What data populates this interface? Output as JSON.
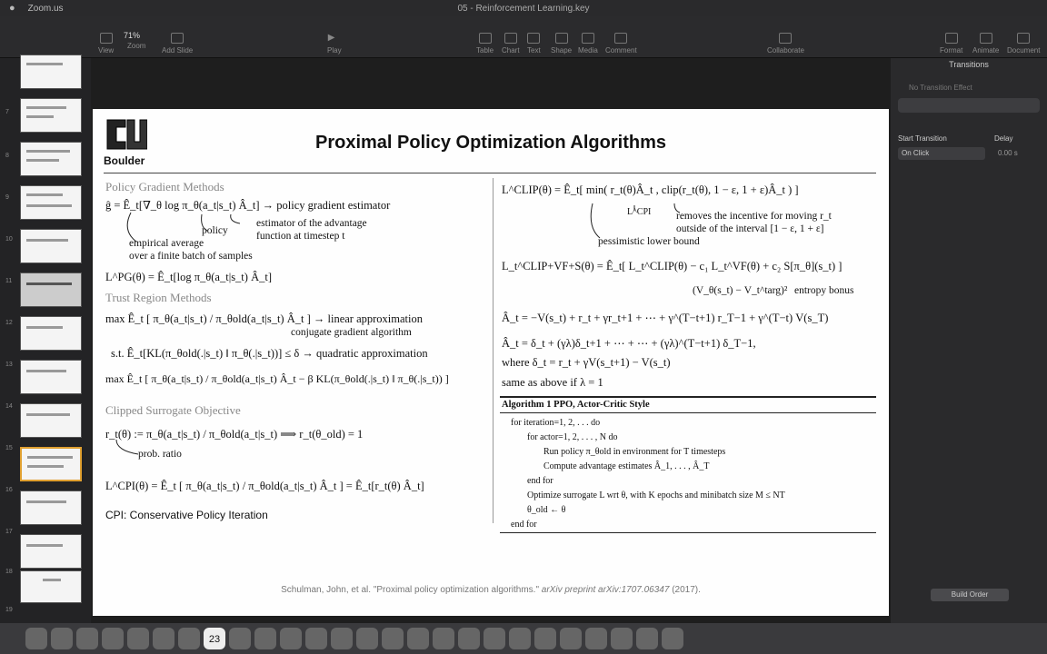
{
  "app": {
    "window_title": "05 - Reinforcement Learning.key",
    "menu_left": "Zoom.us",
    "zoom_level": "71%"
  },
  "toolbar": {
    "items": [
      "View",
      "Zoom",
      "Add Slide",
      "Play",
      "Table",
      "Chart",
      "Text",
      "Shape",
      "Media",
      "Comment",
      "Collaborate",
      "Format",
      "Animate",
      "Document"
    ]
  },
  "sidebar": {
    "slide_numbers": [
      "7",
      "8",
      "9",
      "10",
      "11",
      "12",
      "13",
      "14",
      "15",
      "16",
      "17",
      "18",
      "19"
    ]
  },
  "inspector": {
    "tab": "Transitions",
    "none": "No Transition Effect",
    "start_transition_label": "Start Transition",
    "delay_label": "Delay",
    "start_value": "On Click",
    "delay_value": "0.00 s",
    "build_order": "Build Order"
  },
  "dock": {
    "calendar_day": "23"
  },
  "slide": {
    "brand": "Boulder",
    "title": "Proximal Policy Optimization Algorithms",
    "sec_pg": "Policy Gradient Methods",
    "pg_eq": "ĝ = Ê_t[∇_θ log π_θ(a_t|s_t) Â_t] → policy gradient estimator",
    "pg_policy": "policy",
    "pg_adv1": "estimator of the advantage",
    "pg_adv2": "function at timestep t",
    "pg_emp1": "empirical average",
    "pg_emp2": "over a finite batch of samples",
    "lpg": "L^PG(θ) = Ê_t[log π_θ(a_t|s_t) Â_t]",
    "sec_tr": "Trust Region Methods",
    "tr_max": "max  Ê_t [ π_θ(a_t|s_t) / π_θold(a_t|s_t) Â_t ] → linear approximation",
    "tr_cg": "conjugate gradient algorithm",
    "tr_st": "s.t.  Ê_t[KL(π_θold(.|s_t) ‖ π_θ(.|s_t))] ≤ δ → quadratic approximation",
    "tr_pen": "max  Ê_t [ π_θ(a_t|s_t) / π_θold(a_t|s_t) Â_t − β KL(π_θold(.|s_t) ‖ π_θ(.|s_t)) ]",
    "sec_cs": "Clipped Surrogate Objective",
    "rt_def": "r_t(θ) := π_θ(a_t|s_t) / π_θold(a_t|s_t)  ⟹  r_t(θ_old) = 1",
    "rt_note": "prob. ratio",
    "lcpi": "L^CPI(θ) = Ê_t [ π_θ(a_t|s_t) / π_θold(a_t|s_t) Â_t ] = Ê_t[r_t(θ) Â_t]",
    "cpi": "CPI: Conservative Policy Iteration",
    "lclip": "L^CLIP(θ) = Ê_t[ min( r_t(θ)Â_t , clip(r_t(θ), 1 − ε, 1 + ε)Â_t ) ]",
    "lclip_cpi": "L^CPI",
    "lclip_n1": "removes the incentive for moving r_t",
    "lclip_n2": "outside of the interval [1 − ε, 1 + ε]",
    "lclip_pess": "pessimistic lower bound",
    "lfull": "L_t^CLIP+VF+S(θ) = Ê_t[ L_t^CLIP(θ) − c₁ L_t^VF(θ) + c₂ S[π_θ](s_t) ]",
    "lvf": "(V_θ(s_t) − V_t^targ)²",
    "entropy": "entropy bonus",
    "adv1": "Â_t = −V(s_t) + r_t + γr_t+1 + ⋯ + γ^(T−t+1) r_T−1 + γ^(T−t) V(s_T)",
    "adv2": "Â_t = δ_t + (γλ)δ_t+1 + ⋯ + ⋯ + (γλ)^(T−t+1) δ_T−1,",
    "adv_where": "where   δ_t = r_t + γV(s_t+1) − V(s_t)",
    "adv_same": "same as above if λ = 1",
    "algo_title": "Algorithm 1 PPO, Actor-Critic Style",
    "algo_lines": [
      "for iteration=1, 2, . . .  do",
      "for actor=1, 2, . . . , N  do",
      "Run policy π_θold in environment for T timesteps",
      "Compute advantage estimates Â_1, . . . , Â_T",
      "end for",
      "Optimize surrogate L wrt θ, with K epochs and minibatch size M ≤ NT",
      "θ_old ← θ",
      "end for"
    ],
    "cite_main": "Schulman, John, et al. \"Proximal policy optimization algorithms.\" ",
    "cite_journal": "arXiv preprint arXiv:1707.06347",
    "cite_year": " (2017)."
  }
}
